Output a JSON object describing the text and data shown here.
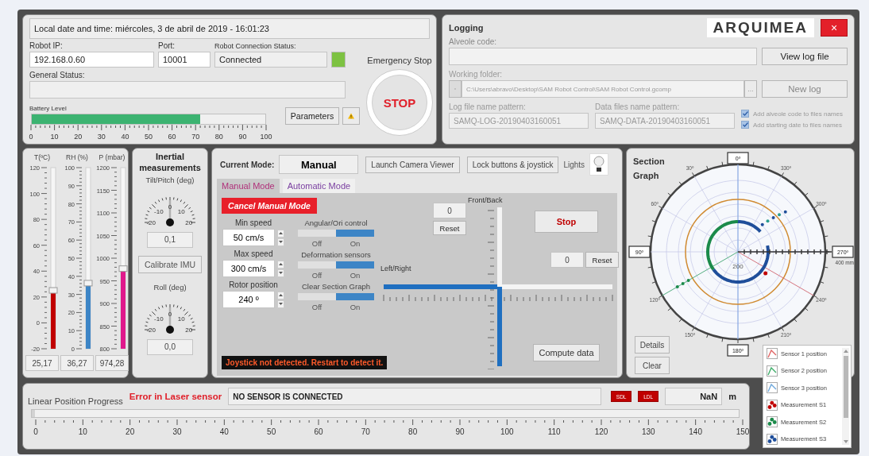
{
  "header": {
    "datetime": "Local date and time: miércoles, 3 de abril de 2019 - 16:01:23"
  },
  "connection": {
    "ip_label": "Robot IP:",
    "ip": "192.168.0.60",
    "port_label": "Port:",
    "port": "10001",
    "status_label": "Robot Connection Status:",
    "status": "Connected",
    "connected": true,
    "general_label": "General Status:"
  },
  "battery": {
    "label": "Battery Level",
    "level": 0.72,
    "ticks": [
      "0",
      "10",
      "20",
      "30",
      "40",
      "50",
      "60",
      "70",
      "80",
      "90",
      "100"
    ]
  },
  "parameters": {
    "label": "Parameters",
    "warning": true
  },
  "emergency": {
    "label": "Emergency Stop",
    "button": "STOP"
  },
  "logging": {
    "title": "Logging",
    "logo": "ARQUIMEA",
    "close": "×",
    "alveole_label": "Alveole code:",
    "view_log": "View log file",
    "folder_label": "Working folder:",
    "folder": "C:\\Users\\abravo\\Desktop\\SAM Robot Control\\SAM Robot Control.gcomp",
    "browse": "...",
    "new_log": "New log",
    "log_pattern_label": "Log file name pattern:",
    "log_pattern": "SAMQ-LOG-20190403160051",
    "data_pattern_label": "Data files name pattern:",
    "data_pattern": "SAMQ-DATA-20190403160051",
    "options": [
      {
        "label": "Add alveole code to files names",
        "checked": true
      },
      {
        "label": "Add starting date to files names",
        "checked": true
      }
    ]
  },
  "environment": {
    "sensors": [
      {
        "label": "T(ºC)",
        "scale": [
          "120",
          "100",
          "80",
          "60",
          "40",
          "20",
          "0",
          "-20"
        ],
        "level": 0.32,
        "value": "25,17",
        "color": "#c00000"
      },
      {
        "label": "RH (%)",
        "scale": [
          "100",
          "90",
          "80",
          "70",
          "60",
          "50",
          "40",
          "30",
          "20",
          "10",
          "0"
        ],
        "level": 0.36,
        "value": "36,27",
        "color": "#3d85c6"
      },
      {
        "label": "P (mbar)",
        "scale": [
          "1200",
          "1150",
          "1100",
          "1050",
          "1000",
          "950",
          "900",
          "850",
          "800"
        ],
        "level": 0.44,
        "value": "974,28",
        "color": "#e0188c"
      }
    ]
  },
  "inertial": {
    "title": "Inertial measurements",
    "calibrate": "Calibrate IMU",
    "dials": [
      {
        "label": "Tilt/Pitch (deg)",
        "ticks": [
          "-20",
          "-10",
          "0",
          "10",
          "20"
        ],
        "value": "0,1"
      },
      {
        "label": "Roll (deg)",
        "ticks": [
          "-20",
          "-10",
          "0",
          "10",
          "20"
        ],
        "value": "0,0"
      }
    ]
  },
  "control": {
    "mode_label": "Current Mode:",
    "mode": "Manual",
    "buttons": [
      "Launch Camera Viewer",
      "Lock buttons & joystick"
    ],
    "lights_label": "Lights",
    "tabs": [
      {
        "label": "Manual Mode",
        "selected": true
      },
      {
        "label": "Automatic Mode",
        "selected": false
      }
    ],
    "cancel": "Cancel Manual Mode",
    "spinners": [
      {
        "label": "Min speed",
        "value": "50 cm/s"
      },
      {
        "label": "Max speed",
        "value": "300 cm/s"
      },
      {
        "label": "Rotor position",
        "value": "240 º"
      }
    ],
    "toggles": [
      {
        "label": "Angular/Ori control",
        "off_label": "Off",
        "on_label": "On",
        "on": true
      },
      {
        "label": "Deformation sensors",
        "off_label": "Off",
        "on_label": "On",
        "on": true
      },
      {
        "label": "Clear Section Graph",
        "off_label": "Off",
        "on_label": "On",
        "on": true
      }
    ],
    "joystick_message": "Joystick not detected. Restart to detect it.",
    "front_back": {
      "label": "Front/Back",
      "value": "0",
      "reset": "Reset",
      "level": 0.5
    },
    "left_right": {
      "label": "Left/Right",
      "value": "0",
      "reset": "Reset",
      "level": 0.5
    },
    "stop": "Stop",
    "compute": "Compute data"
  },
  "section": {
    "title": "Section Graph",
    "angle_labels": [
      "0º",
      "30º",
      "60º",
      "90º",
      "120º",
      "150º",
      "180º",
      "210º",
      "240º",
      "270º",
      "300º",
      "330º"
    ],
    "radius_labels": [
      "200",
      "400 mm"
    ],
    "details": "Details",
    "clear": "Clear",
    "legend": [
      {
        "label": "Sensor 1 position",
        "kind": "line",
        "color": "#e06666"
      },
      {
        "label": "Sensor 2 position",
        "kind": "line",
        "color": "#3fae6a"
      },
      {
        "label": "Sensor 3 position",
        "kind": "line",
        "color": "#6fa8dc"
      },
      {
        "label": "Measurement S1",
        "kind": "points",
        "color": "#c00000"
      },
      {
        "label": "Measurement S2",
        "kind": "points",
        "color": "#1b8a4a"
      },
      {
        "label": "Measurement S3",
        "kind": "points",
        "color": "#1f4e9a"
      }
    ]
  },
  "linear": {
    "label": "Linear Position Progress",
    "error": "Error in Laser sensor",
    "message": "NO SENSOR IS CONNECTED",
    "sdl": "SDL",
    "ldl": "LDL",
    "value": "NaN",
    "unit": "m",
    "level": 0,
    "ticks": [
      "0",
      "10",
      "20",
      "30",
      "40",
      "50",
      "60",
      "70",
      "80",
      "90",
      "100",
      "110",
      "120",
      "130",
      "140",
      "150"
    ]
  }
}
